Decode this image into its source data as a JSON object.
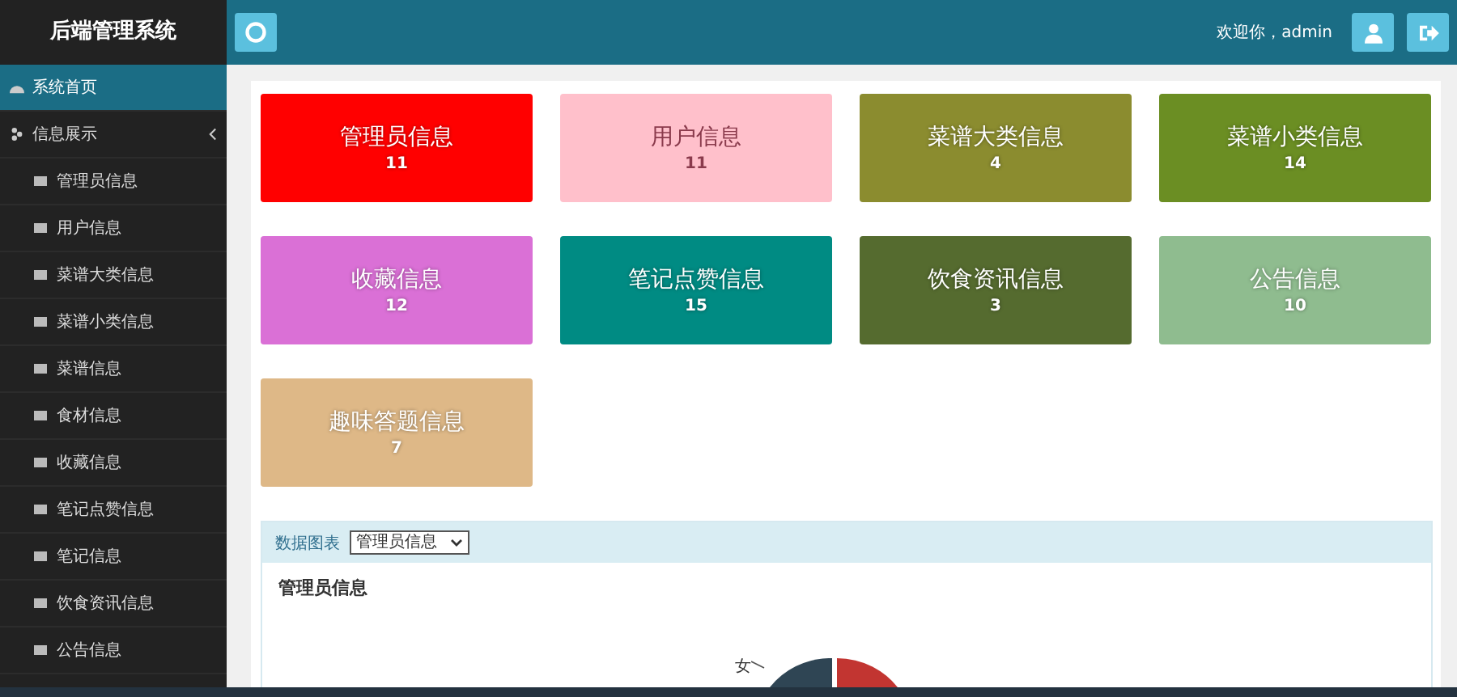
{
  "header": {
    "title": "后端管理系统",
    "welcome": "欢迎你，admin"
  },
  "sidebar": {
    "items": [
      {
        "kind": "link",
        "label": "系统首页",
        "selected": true
      },
      {
        "kind": "group",
        "label": "信息展示",
        "selected": false,
        "expanded": true,
        "children": [
          {
            "label": "管理员信息",
            "selected": false
          },
          {
            "label": "用户信息",
            "selected": false
          },
          {
            "label": "菜谱大类信息",
            "selected": false
          },
          {
            "label": "菜谱小类信息",
            "selected": false
          },
          {
            "label": "菜谱信息",
            "selected": false
          },
          {
            "label": "食材信息",
            "selected": false
          },
          {
            "label": "收藏信息",
            "selected": false
          },
          {
            "label": "笔记点赞信息",
            "selected": false
          },
          {
            "label": "笔记信息",
            "selected": false
          },
          {
            "label": "饮食资讯信息",
            "selected": false
          },
          {
            "label": "公告信息",
            "selected": false
          }
        ]
      }
    ]
  },
  "cards": [
    {
      "title": "管理员信息",
      "count": "11",
      "color": "#ff0000"
    },
    {
      "title": "用户信息",
      "count": "11",
      "color": "#ffc0cb"
    },
    {
      "title": "菜谱大类信息",
      "count": "4",
      "color": "#8b8c2f"
    },
    {
      "title": "菜谱小类信息",
      "count": "14",
      "color": "#6b8e23"
    },
    {
      "title": "收藏信息",
      "count": "12",
      "color": "#da70d6"
    },
    {
      "title": "笔记点赞信息",
      "count": "15",
      "color": "#008b83"
    },
    {
      "title": "饮食资讯信息",
      "count": "3",
      "color": "#556b2f"
    },
    {
      "title": "公告信息",
      "count": "10",
      "color": "#8fbc8f"
    },
    {
      "title": "趣味答题信息",
      "count": "7",
      "color": "#deb887"
    }
  ],
  "chart_panel": {
    "label": "数据图表",
    "select_value": "管理员信息",
    "title": "管理员信息",
    "pie_label": "女"
  }
}
